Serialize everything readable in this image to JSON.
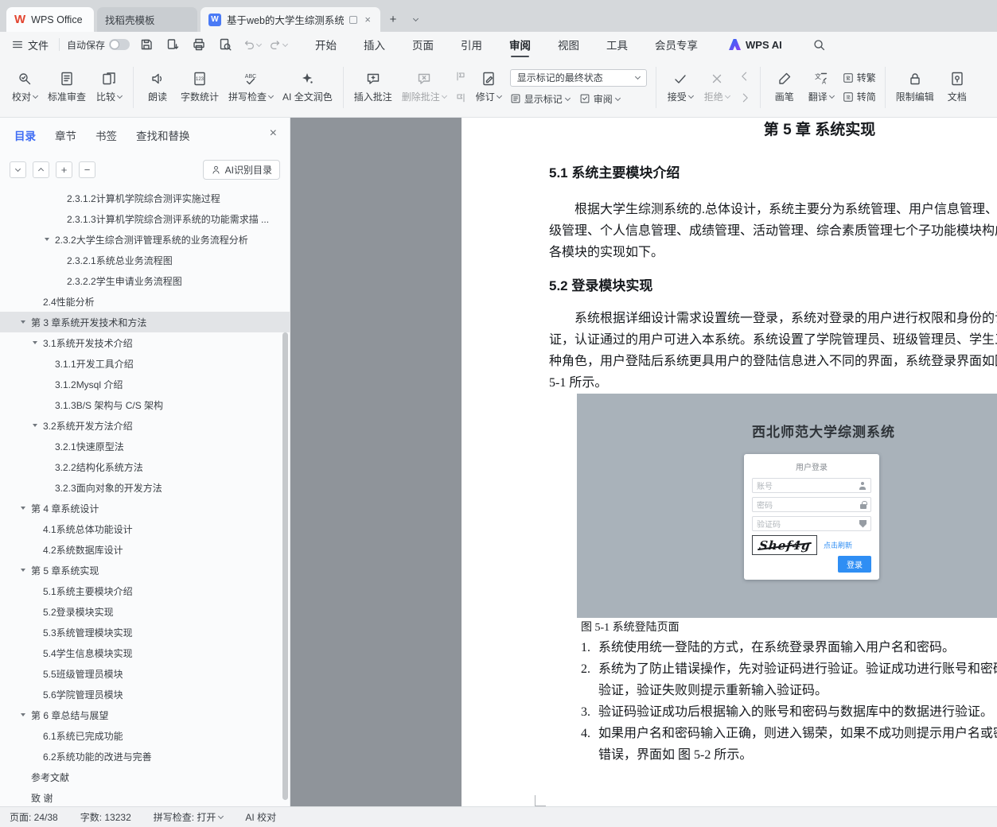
{
  "colors": {
    "accent_blue": "#3f6df4",
    "wps_red": "#e2442f",
    "login_button_blue": "#2f8ef4",
    "doc_bg_gray": "#8f949a",
    "figure_bg": "#a9b2ba"
  },
  "tabbar": {
    "home_tab": "WPS Office",
    "docer_tab": "找稻壳模板",
    "doc_tab": "基于web的大学生综测系统设"
  },
  "quickbar": {
    "file": "文件",
    "autosave": "自动保存"
  },
  "ribbon_tabs": [
    "开始",
    "插入",
    "页面",
    "引用",
    "审阅",
    "视图",
    "工具",
    "会员专享"
  ],
  "wps_ai": "WPS AI",
  "ribbon": {
    "proofread": "校对",
    "standard_review": "标准审查",
    "compare": "比较",
    "read_aloud": "朗读",
    "word_count": "字数统计",
    "spell_check": "拼写检查",
    "ai_polish": "AI 全文润色",
    "insert_comment": "插入批注",
    "delete_comment": "删除批注",
    "track_changes": "修订",
    "markup_state": "显示标记的最终状态",
    "show_markup": "显示标记",
    "review": "审阅",
    "accept": "接受",
    "reject": "拒绝",
    "brush": "画笔",
    "translate": "翻译",
    "to_traditional": "转繁",
    "to_simplified": "转简",
    "restrict_edit": "限制编辑",
    "doc_permission": "文档"
  },
  "sidebar": {
    "tabs": [
      "目录",
      "章节",
      "书签",
      "查找和替换"
    ],
    "ai_button": "AI识别目录",
    "tree": [
      {
        "label": "2.3.1.2计算机学院综合测评实施过程",
        "level": 3
      },
      {
        "label": "2.3.1.3计算机学院综合测评系统的功能需求描 ...",
        "level": 3
      },
      {
        "label": "2.3.2大学生综合测评管理系统的业务流程分析",
        "level": 2,
        "arrow": true
      },
      {
        "label": "2.3.2.1系统总业务流程图",
        "level": 3
      },
      {
        "label": "2.3.2.2学生申请业务流程图",
        "level": 3
      },
      {
        "label": "2.4性能分析",
        "level": 1
      },
      {
        "label": "第 3 章系统开发技术和方法",
        "level": 0,
        "arrow": true,
        "selected": true
      },
      {
        "label": "3.1系统开发技术介绍",
        "level": 1,
        "arrow": true
      },
      {
        "label": "3.1.1开发工具介绍",
        "level": 2
      },
      {
        "label": "3.1.2Mysql 介绍",
        "level": 2
      },
      {
        "label": "3.1.3B/S 架构与 C/S 架构",
        "level": 2
      },
      {
        "label": "3.2系统开发方法介绍",
        "level": 1,
        "arrow": true
      },
      {
        "label": "3.2.1快速原型法",
        "level": 2
      },
      {
        "label": "3.2.2结构化系统方法",
        "level": 2
      },
      {
        "label": "3.2.3面向对象的开发方法",
        "level": 2
      },
      {
        "label": "第 4 章系统设计",
        "level": 0,
        "arrow": true
      },
      {
        "label": "4.1系统总体功能设计",
        "level": 1
      },
      {
        "label": "4.2系统数据库设计",
        "level": 1
      },
      {
        "label": "第 5 章系统实现",
        "level": 0,
        "arrow": true
      },
      {
        "label": "5.1系统主要模块介绍",
        "level": 1
      },
      {
        "label": "5.2登录模块实现",
        "level": 1
      },
      {
        "label": "5.3系统管理模块实现",
        "level": 1
      },
      {
        "label": "5.4学生信息模块实现",
        "level": 1
      },
      {
        "label": "5.5班级管理员模块",
        "level": 1
      },
      {
        "label": "5.6学院管理员模块",
        "level": 1
      },
      {
        "label": "第 6 章总结与展望",
        "level": 0,
        "arrow": true
      },
      {
        "label": "6.1系统已完成功能",
        "level": 1
      },
      {
        "label": "6.2系统功能的改进与完善",
        "level": 1
      },
      {
        "label": "参考文献",
        "level": 0
      },
      {
        "label": "致 谢",
        "level": 0
      }
    ]
  },
  "document": {
    "chapter_title": "第 5 章 系统实现",
    "section1_title": "5.1 系统主要模块介绍",
    "para1_lines": [
      "根据大学生综测系统的.总体设计，系统主要分为系统管理、用户信息管理、班",
      "级管理、个人信息管理、成绩管理、活动管理、综合素质管理七个子功能模块构成",
      "各模块的实现如下。"
    ],
    "section2_title": "5.2 登录模块实现",
    "para2_lines": [
      "系统根据详细设计需求设置统一登录，系统对登录的用户进行权限和身份的认",
      "证，认证通过的用户可进入本系统。系统设置了学院管理员、班级管理员、学生三",
      "种角色，用户登陆后系统更具用户的登陆信息进入不同的界面，系统登录界面如图",
      "5-1 所示。"
    ],
    "figure": {
      "system_title": "西北师范大学综测系统",
      "form_title": "用户登录",
      "account_placeholder": "账号",
      "password_placeholder": "密码",
      "captcha_placeholder": "验证码",
      "captcha_text": "Shef4g",
      "refresh_link": "点击刷新",
      "login_button": "登录"
    },
    "caption": "图 5-1 系统登陆页面",
    "list": [
      {
        "num": "1.",
        "lines": [
          "系统使用统一登陆的方式，在系统登录界面输入用户名和密码。"
        ]
      },
      {
        "num": "2.",
        "lines": [
          "系统为了防止错误操作，先对验证码进行验证。验证成功进行账号和密码",
          "验证，验证失败则提示重新输入验证码。"
        ]
      },
      {
        "num": "3.",
        "lines": [
          "验证码验证成功后根据输入的账号和密码与数据库中的数据进行验证。"
        ]
      },
      {
        "num": "4.",
        "lines": [
          "如果用户名和密码输入正确，则进入锡荣，如果不成功则提示用户名或密",
          "错误，界面如 图 5-2 所示。"
        ]
      }
    ]
  },
  "statusbar": {
    "page": "页面: 24/38",
    "words": "字数: 13232",
    "spell": "拼写检查: 打开",
    "ai_proof": "AI 校对"
  }
}
